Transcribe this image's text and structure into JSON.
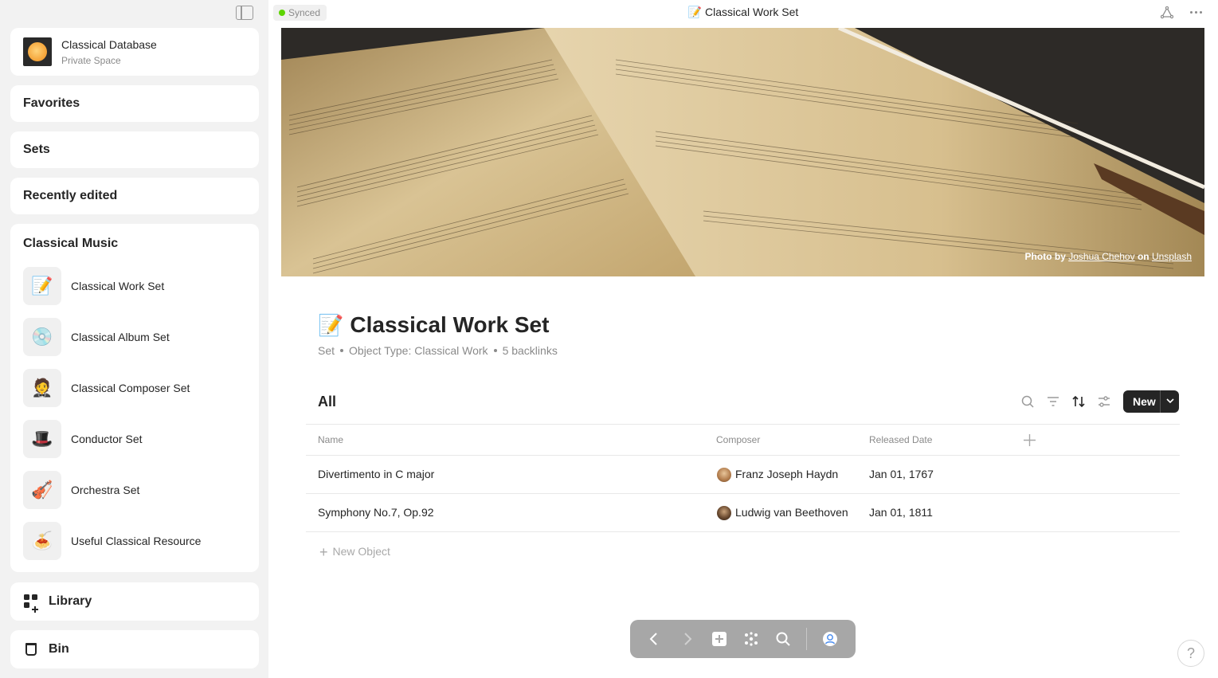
{
  "sidebar": {
    "space": {
      "name": "Classical Database",
      "subtitle": "Private Space"
    },
    "sections": [
      "Favorites",
      "Sets",
      "Recently edited"
    ],
    "group": {
      "title": "Classical Music",
      "items": [
        {
          "label": "Classical Work Set",
          "icon": "📝"
        },
        {
          "label": "Classical Album Set",
          "icon": "💿"
        },
        {
          "label": "Classical Composer Set",
          "icon": "🤵"
        },
        {
          "label": "Conductor Set",
          "icon": "🎩"
        },
        {
          "label": "Orchestra Set",
          "icon": "🎻"
        },
        {
          "label": "Useful Classical Resource",
          "icon": "🍝"
        }
      ]
    },
    "library_label": "Library",
    "bin_label": "Bin"
  },
  "topbar": {
    "sync_status": "Synced",
    "title": "📝 Classical Work Set"
  },
  "cover": {
    "credit_prefix": "Photo by",
    "photographer": "Joshua Chehov",
    "credit_on": "on",
    "source": "Unsplash"
  },
  "page": {
    "emoji": "📝",
    "title": "Classical Work Set",
    "meta": [
      "Set",
      "Object Type: Classical Work",
      "5 backlinks"
    ]
  },
  "view": {
    "name": "All",
    "new_label": "New",
    "columns": [
      "Name",
      "Composer",
      "Released Date"
    ],
    "rows": [
      {
        "name": "Divertimento in C major",
        "composer": "Franz Joseph Haydn",
        "date": "Jan 01, 1767"
      },
      {
        "name": "Symphony No.7, Op.92",
        "composer": "Ludwig van Beethoven",
        "date": "Jan 01, 1811"
      }
    ],
    "new_object_label": "New Object"
  },
  "help_label": "?",
  "colors": {
    "accent": "#252525",
    "synced": "#5dd400",
    "navbar": "#a7a7a7"
  }
}
